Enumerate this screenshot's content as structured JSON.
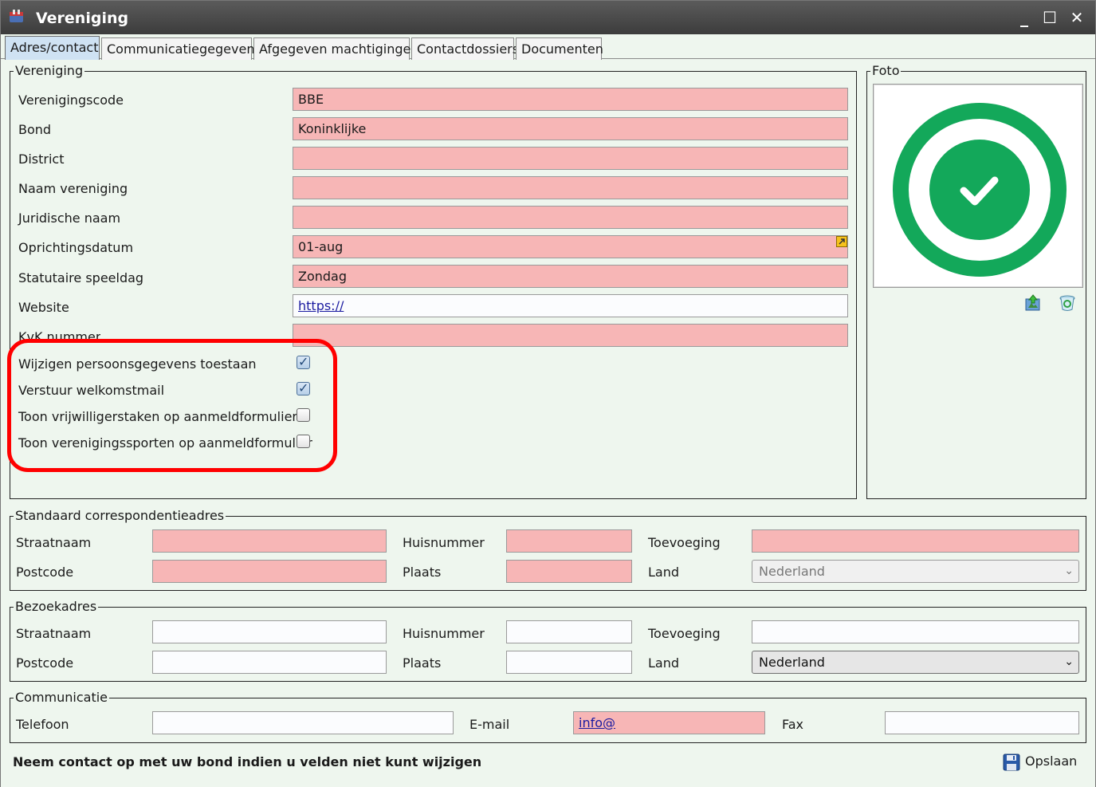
{
  "window": {
    "title": "Vereniging",
    "controls": {
      "minimize": "_",
      "maximize": "☐",
      "close": "✕"
    }
  },
  "tabs": [
    {
      "label": "Adres/contact",
      "active": true
    },
    {
      "label": "Communicatiegegevens",
      "active": false
    },
    {
      "label": "Afgegeven machtigingen",
      "active": false
    },
    {
      "label": "Contactdossiers",
      "active": false
    },
    {
      "label": "Documenten",
      "active": false
    }
  ],
  "vereniging": {
    "legend": "Vereniging",
    "fields": [
      {
        "label": "Verenigingscode",
        "value": "BBE",
        "style": "required"
      },
      {
        "label": "Bond",
        "value": "Koninklijke",
        "style": "required"
      },
      {
        "label": "District",
        "value": "",
        "style": "required"
      },
      {
        "label": "Naam vereniging",
        "value": "",
        "style": "required"
      },
      {
        "label": "Juridische naam",
        "value": "",
        "style": "required"
      },
      {
        "label": "Oprichtingsdatum",
        "value": "01-aug",
        "style": "required"
      },
      {
        "label": "Statutaire speeldag",
        "value": "Zondag",
        "style": "required"
      },
      {
        "label": "Website",
        "value": "https://",
        "style": "link"
      },
      {
        "label": "KvK nummer",
        "value": "",
        "style": "required"
      }
    ],
    "checkboxes": [
      {
        "label": "Wijzigen persoonsgegevens toestaan",
        "checked": true
      },
      {
        "label": "Verstuur welkomstmail",
        "checked": true
      },
      {
        "label": "Toon vrijwilligerstaken op aanmeldformulier",
        "checked": false
      },
      {
        "label": "Toon verenigingssporten op aanmeldformulier",
        "checked": false
      }
    ]
  },
  "foto": {
    "legend": "Foto",
    "upload_icon": "upload-photo-icon",
    "delete_icon": "recycle-bin-icon"
  },
  "correspondentieadres": {
    "legend": "Standaard correspondentieadres",
    "straatnaam_label": "Straatnaam",
    "huisnummer_label": "Huisnummer",
    "toevoeging_label": "Toevoeging",
    "postcode_label": "Postcode",
    "plaats_label": "Plaats",
    "land_label": "Land",
    "land_value": "Nederland"
  },
  "bezoekadres": {
    "legend": "Bezoekadres",
    "straatnaam_label": "Straatnaam",
    "huisnummer_label": "Huisnummer",
    "toevoeging_label": "Toevoeging",
    "postcode_label": "Postcode",
    "plaats_label": "Plaats",
    "land_label": "Land",
    "land_value": "Nederland"
  },
  "communicatie": {
    "legend": "Communicatie",
    "telefoon_label": "Telefoon",
    "email_label": "E-mail",
    "email_value": "info@",
    "fax_label": "Fax"
  },
  "footer": {
    "message": "Neem contact op met uw bond indien u velden niet kunt wijzigen",
    "save_label": "Opslaan"
  },
  "colors": {
    "required_field": "#f7b6b6",
    "highlight_ring": "#ff0000",
    "photo_green": "#13a85a",
    "background": "#eef6ee"
  }
}
